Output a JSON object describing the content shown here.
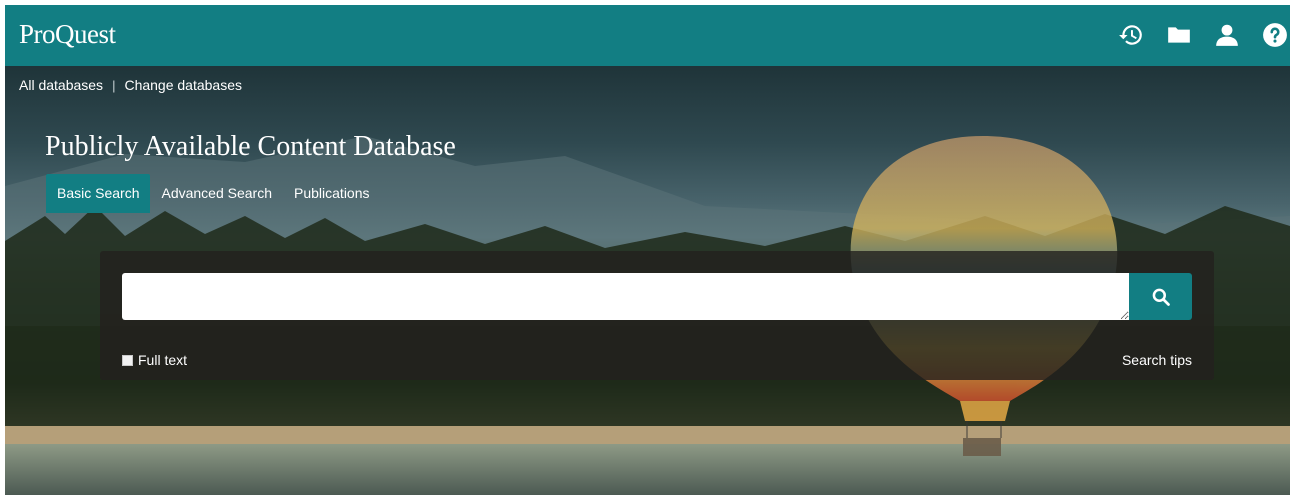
{
  "app": {
    "logo": "ProQuest"
  },
  "header": {
    "icons": [
      "history-icon",
      "folder-icon",
      "user-icon",
      "help-icon"
    ]
  },
  "breadcrumb": {
    "all_databases": "All databases",
    "separator": "|",
    "change_databases": "Change databases"
  },
  "database": {
    "title": "Publicly Available Content Database"
  },
  "tabs": [
    {
      "label": "Basic Search",
      "active": true
    },
    {
      "label": "Advanced Search",
      "active": false
    },
    {
      "label": "Publications",
      "active": false
    }
  ],
  "search": {
    "value": "",
    "placeholder": "",
    "button_icon": "search-icon",
    "full_text_label": "Full text",
    "full_text_checked": false,
    "tips_label": "Search tips"
  },
  "colors": {
    "brand": "#127e83",
    "panel": "#23211e"
  }
}
